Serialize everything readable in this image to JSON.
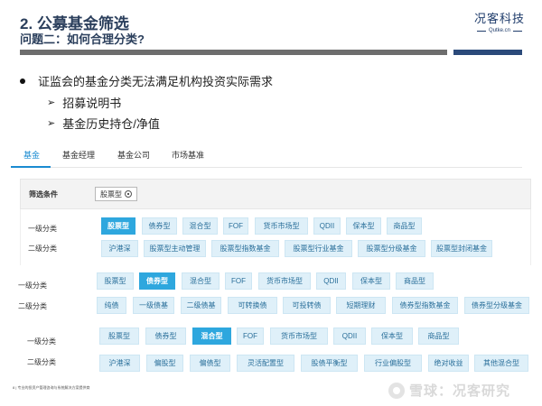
{
  "header": {
    "title": "2. 公募基金筛选",
    "subtitle": "问题二：如何合理分类?",
    "logo_cn": "况客科技",
    "logo_en": "Qutke.cn"
  },
  "bullets": {
    "main": "证监会的基金分类无法满足机构投资实际需求",
    "sub": [
      "招募说明书",
      "基金历史持仓/净值"
    ]
  },
  "tabs": [
    "基金",
    "基金经理",
    "基金公司",
    "市场基准"
  ],
  "filter": {
    "label": "筛选条件",
    "chip": "股票型"
  },
  "panels": [
    {
      "level1_label": "一级分类",
      "level2_label": "二级分类",
      "level1": [
        "股票型",
        "债券型",
        "混合型",
        "FOF",
        "货币市场型",
        "QDII",
        "保本型",
        "商品型"
      ],
      "level1_selected": "股票型",
      "level2": [
        "沪港深",
        "股票型主动管理",
        "股票型指数基金",
        "股票型行业基金",
        "股票型分级基金",
        "股票型封闭基金"
      ]
    },
    {
      "level1_label": "一级分类",
      "level2_label": "二级分类",
      "level1": [
        "股票型",
        "债券型",
        "混合型",
        "FOF",
        "货币市场型",
        "QDII",
        "保本型",
        "商品型"
      ],
      "level1_selected": "债券型",
      "level2": [
        "纯债",
        "一级债基",
        "二级债基",
        "可转换债",
        "可投转债",
        "短期理财",
        "债券型指数基金",
        "债券型分级基金"
      ]
    },
    {
      "level1_label": "一级分类",
      "level2_label": "二级分类",
      "level1": [
        "股票型",
        "债券型",
        "混合型",
        "FOF",
        "货币市场型",
        "QDII",
        "保本型",
        "商品型"
      ],
      "level1_selected": "混合型",
      "level2": [
        "沪港深",
        "偏股型",
        "偏债型",
        "灵活配置型",
        "股债平衡型",
        "行业偏股型",
        "绝对收益",
        "其他混合型"
      ]
    }
  ],
  "footer": {
    "page": "8",
    "text": "专业的投资产管理咨询与系统解决方案提供商"
  },
  "watermark": "雪球：况客研究",
  "colors": {
    "accent": "#2ea7de",
    "chip_bg": "#dff0f9",
    "title": "#2b3f5c",
    "bar_gray": "#6d6d6d",
    "bar_blue": "#2b4a7a"
  }
}
